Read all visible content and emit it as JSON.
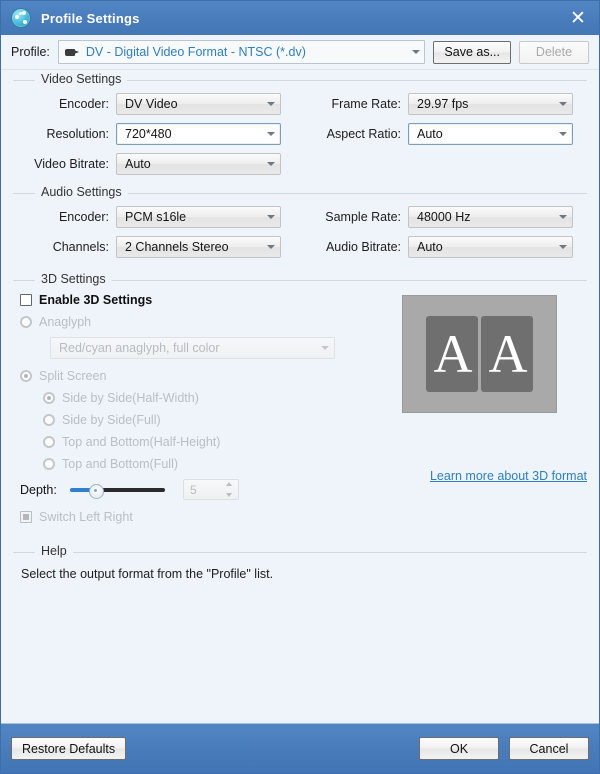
{
  "titlebar": {
    "title": "Profile Settings",
    "icon": "globe-icon",
    "close_label": "✕"
  },
  "profile_bar": {
    "label": "Profile:",
    "icon": "camcorder-icon",
    "value": "DV - Digital Video Format - NTSC (*.dv)",
    "save_as_label": "Save as...",
    "delete_label": "Delete"
  },
  "video_settings": {
    "group_title": "Video Settings",
    "encoder_label": "Encoder:",
    "encoder_value": "DV Video",
    "frame_rate_label": "Frame Rate:",
    "frame_rate_value": "29.97 fps",
    "resolution_label": "Resolution:",
    "resolution_value": "720*480",
    "aspect_ratio_label": "Aspect Ratio:",
    "aspect_ratio_value": "Auto",
    "video_bitrate_label": "Video Bitrate:",
    "video_bitrate_value": "Auto"
  },
  "audio_settings": {
    "group_title": "Audio Settings",
    "encoder_label": "Encoder:",
    "encoder_value": "PCM s16le",
    "sample_rate_label": "Sample Rate:",
    "sample_rate_value": "48000 Hz",
    "channels_label": "Channels:",
    "channels_value": "2 Channels Stereo",
    "audio_bitrate_label": "Audio Bitrate:",
    "audio_bitrate_value": "Auto"
  },
  "threed_settings": {
    "group_title": "3D Settings",
    "enable_label": "Enable 3D Settings",
    "anaglyph_label": "Anaglyph",
    "anaglyph_value": "Red/cyan anaglyph, full color",
    "split_screen_label": "Split Screen",
    "split_options": [
      "Side by Side(Half-Width)",
      "Side by Side(Full)",
      "Top and Bottom(Half-Height)",
      "Top and Bottom(Full)"
    ],
    "depth_label": "Depth:",
    "depth_value": "5",
    "switch_lr_label": "Switch Left Right",
    "learn_more_label": "Learn more about 3D format",
    "preview_left_glyph": "A",
    "preview_right_glyph": "A"
  },
  "help": {
    "group_title": "Help",
    "text": "Select the output format from the \"Profile\" list."
  },
  "footer": {
    "restore_label": "Restore Defaults",
    "ok_label": "OK",
    "cancel_label": "Cancel"
  },
  "colors": {
    "titlebar": "#4a7cbb",
    "panel": "#eef4f9",
    "link": "#2f7fbf",
    "slider_fill": "#2f7fd4"
  }
}
